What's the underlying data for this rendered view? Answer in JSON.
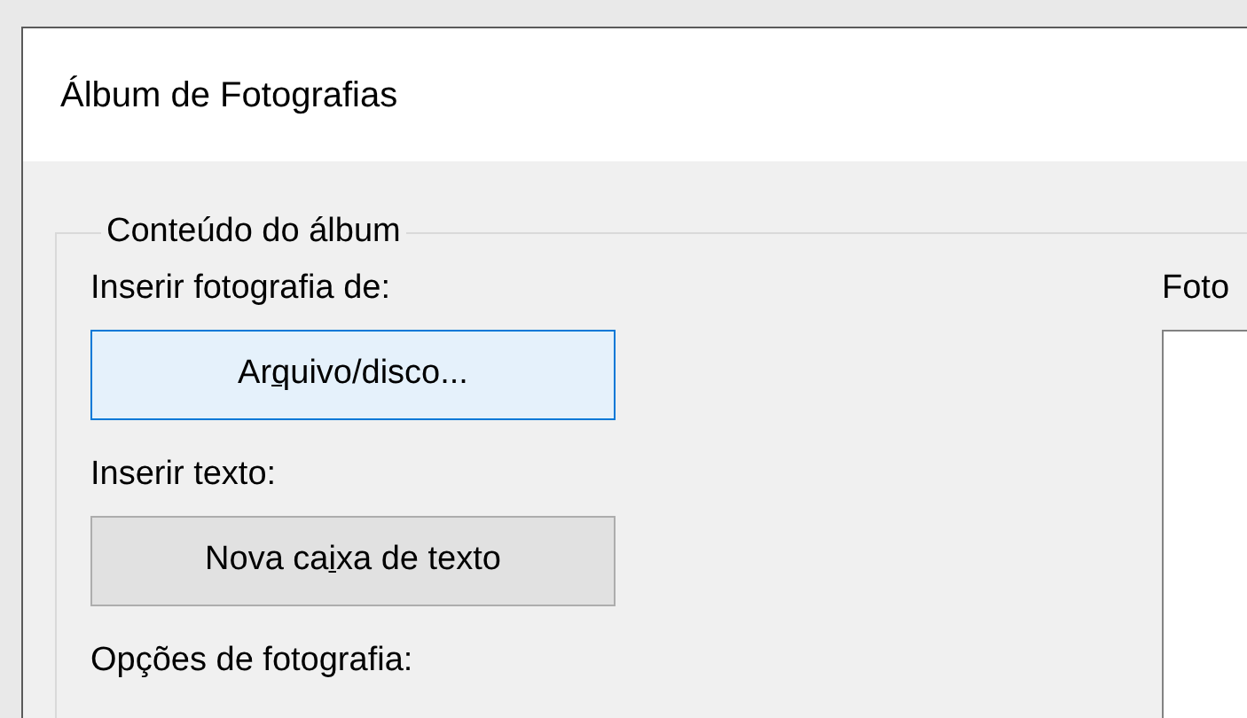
{
  "window": {
    "title": "Álbum de Fotografias"
  },
  "group": {
    "title": "Conteúdo do álbum",
    "insert_picture": {
      "label": "Inserir fotografia de:",
      "button": {
        "label": "Arquivo/disco...",
        "access_key_underlined": true,
        "focused": true
      }
    },
    "insert_text": {
      "label": "Inserir texto:",
      "button": {
        "label": "Nova caixa de texto",
        "access_key_underlined": true,
        "focused": false
      }
    },
    "picture_options": {
      "label": "Opções de fotografia:"
    },
    "pictures_list": {
      "label": "Foto"
    }
  }
}
